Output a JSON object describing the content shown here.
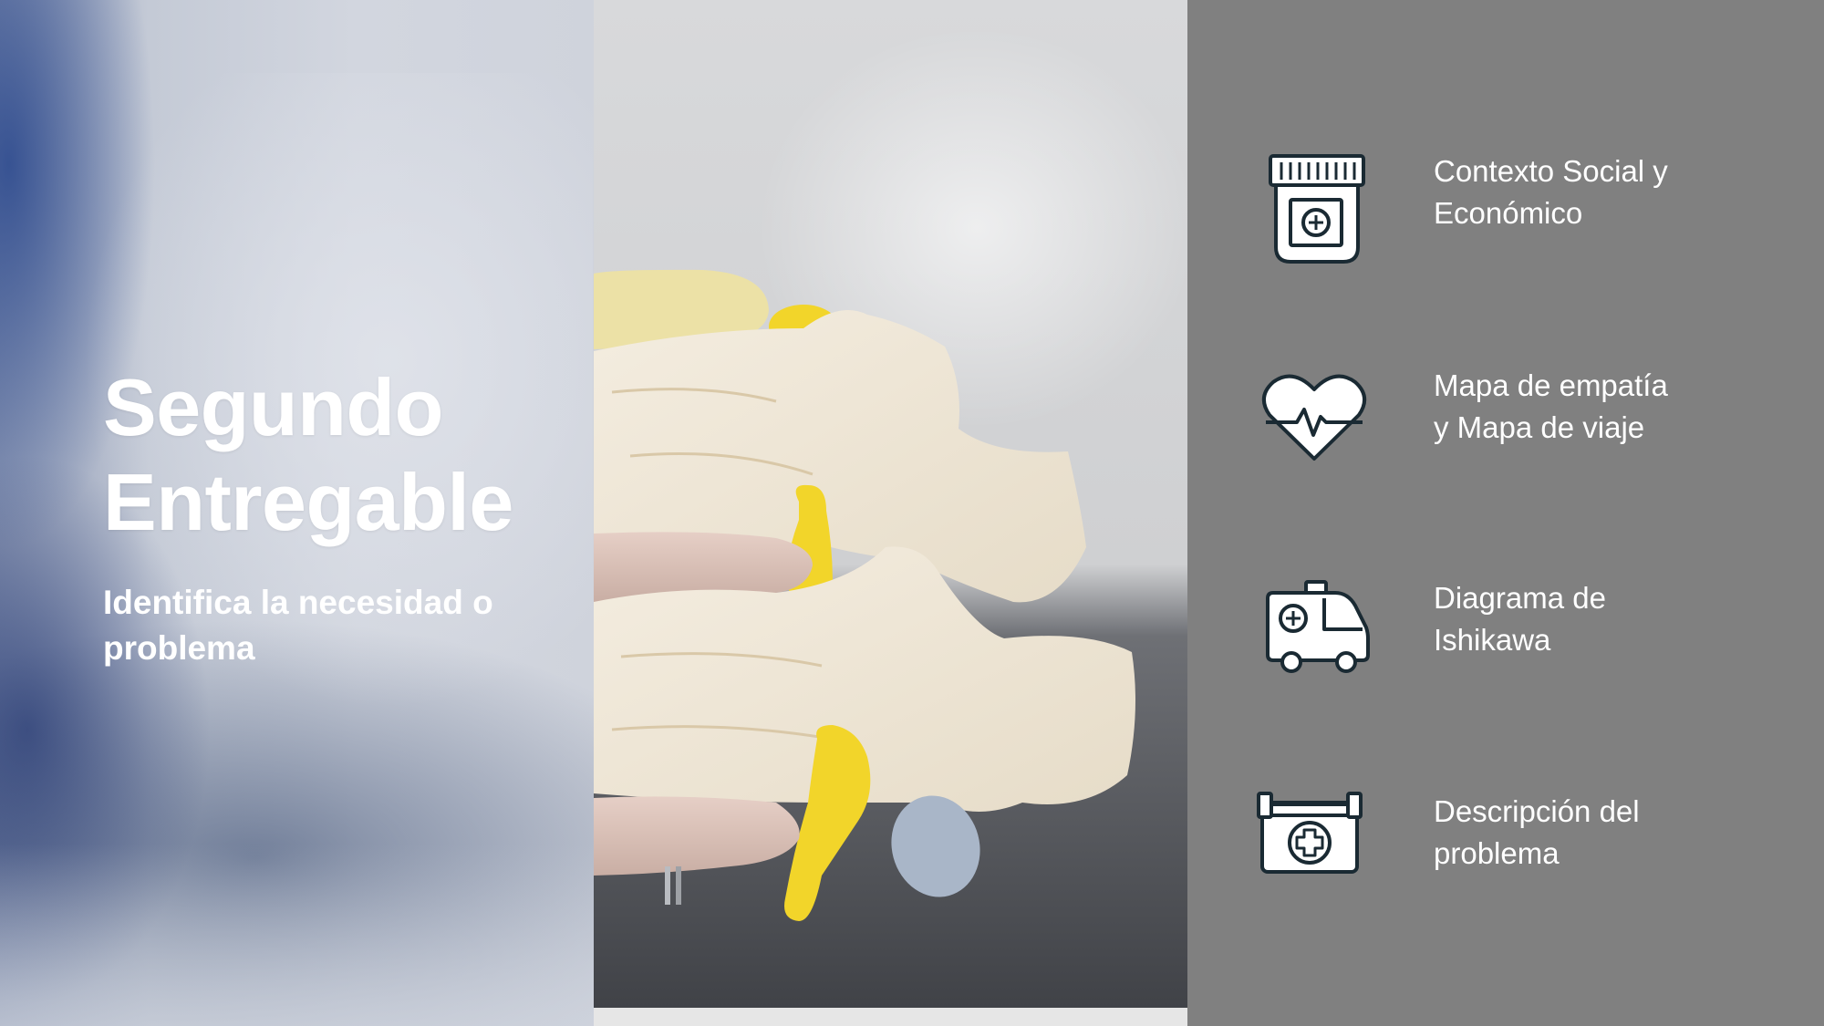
{
  "slide": {
    "title_line1": "Segundo",
    "title_line2": "Entregable",
    "subtitle": "Identifica la necesidad o problema"
  },
  "items": [
    {
      "icon": "medicine-jar-icon",
      "line1": "Contexto Social y",
      "line2": "Económico"
    },
    {
      "icon": "heartbeat-icon",
      "line1": "Mapa de empatía",
      "line2": "y Mapa de viaje"
    },
    {
      "icon": "ambulance-icon",
      "line1": "Diagrama de",
      "line2": "Ishikawa"
    },
    {
      "icon": "first-aid-kit-icon",
      "line1": "Descripción del",
      "line2": "problema"
    }
  ],
  "colors": {
    "right_panel": "#808080",
    "text": "#ffffff",
    "icon_stroke": "#1a2a33"
  }
}
